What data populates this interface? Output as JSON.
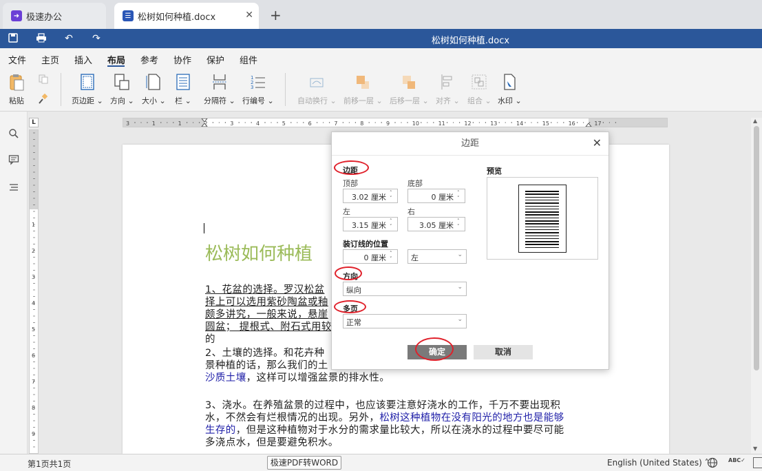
{
  "tabs": [
    {
      "label": "极速办公",
      "active": false
    },
    {
      "label": "松树如何种植.docx",
      "active": true
    }
  ],
  "quickbar": {
    "title": "松树如何种植.docx"
  },
  "menu": [
    "文件",
    "主页",
    "插入",
    "布局",
    "参考",
    "协作",
    "保护",
    "组件"
  ],
  "menu_active": "布局",
  "ribbon": {
    "paste": "粘贴",
    "margins": "页边距",
    "orientation": "方向",
    "size": "大小",
    "columns": "栏",
    "breaks": "分隔符",
    "line_numbers": "行编号",
    "wrap": "自动换行",
    "bring_forward": "前移一层",
    "send_backward": "后移一层",
    "align": "对齐",
    "group": "组合",
    "watermark": "水印"
  },
  "ruler": {
    "h_ticks": [
      "3",
      "1",
      "1",
      "2",
      "3",
      "4",
      "5",
      "6",
      "7",
      "8",
      "9",
      "10",
      "11",
      "12",
      "13",
      "14",
      "15",
      "16",
      "17"
    ],
    "v_ticks": [
      "1",
      "2",
      "3",
      "4",
      "5",
      "6",
      "7",
      "8",
      "9"
    ]
  },
  "document": {
    "heading": "松树如何种植",
    "p1": [
      "1、花盆的选择。罗汉松盆",
      "择上可以选用紫砂陶盆或釉",
      "颇多讲究，一般来说，悬崖",
      "圆盆；  提根式、附石式用较"
    ],
    "p1_tail": "的",
    "p2_line1": "2、土壤的选择。和花卉种",
    "p2_line2": "景种植的话，那么我们的土",
    "p2_blue": "沙质土壤",
    "p2_rest": "，这样可以增强盆景的排水性。",
    "p3_line1": "3、浇水。在养殖盆景的过程中，也应该要注意好浇水的工作，千万不要出现积",
    "p3_line2_a": "水，不然会有烂根情况的出现。另外，",
    "p3_line2_blue": "松树这种植物在没有阳光的地方也是能够",
    "p3_line3_blue": "生存的",
    "p3_line3_rest": "，但是这种植物对于水分的需求量比较大，所以在浇水的过程中要尽可能",
    "p3_line4": "多浇点水，但是要避免积水。"
  },
  "dialog": {
    "title": "边距",
    "section_margins": "边距",
    "top_label": "顶部",
    "top_value": "3.02 厘米",
    "bottom_label": "底部",
    "bottom_value": "0 厘米",
    "left_label": "左",
    "left_value": "3.15 厘米",
    "right_label": "右",
    "right_value": "3.05 厘米",
    "gutter_label": "装订线的位置",
    "gutter_value": "0 厘米",
    "gutter_side": "左",
    "section_orientation": "方向",
    "orientation_value": "纵向",
    "section_pages": "多页",
    "pages_value": "正常",
    "preview_label": "预览",
    "ok": "确定",
    "cancel": "取消"
  },
  "status": {
    "page": "第1页共1页",
    "pdf_button": "极速PDF转WORD",
    "language": "English (United States)"
  },
  "colors": {
    "accent": "#2b579a",
    "heading": "#9bbb59",
    "annotation": "#e0202a"
  }
}
